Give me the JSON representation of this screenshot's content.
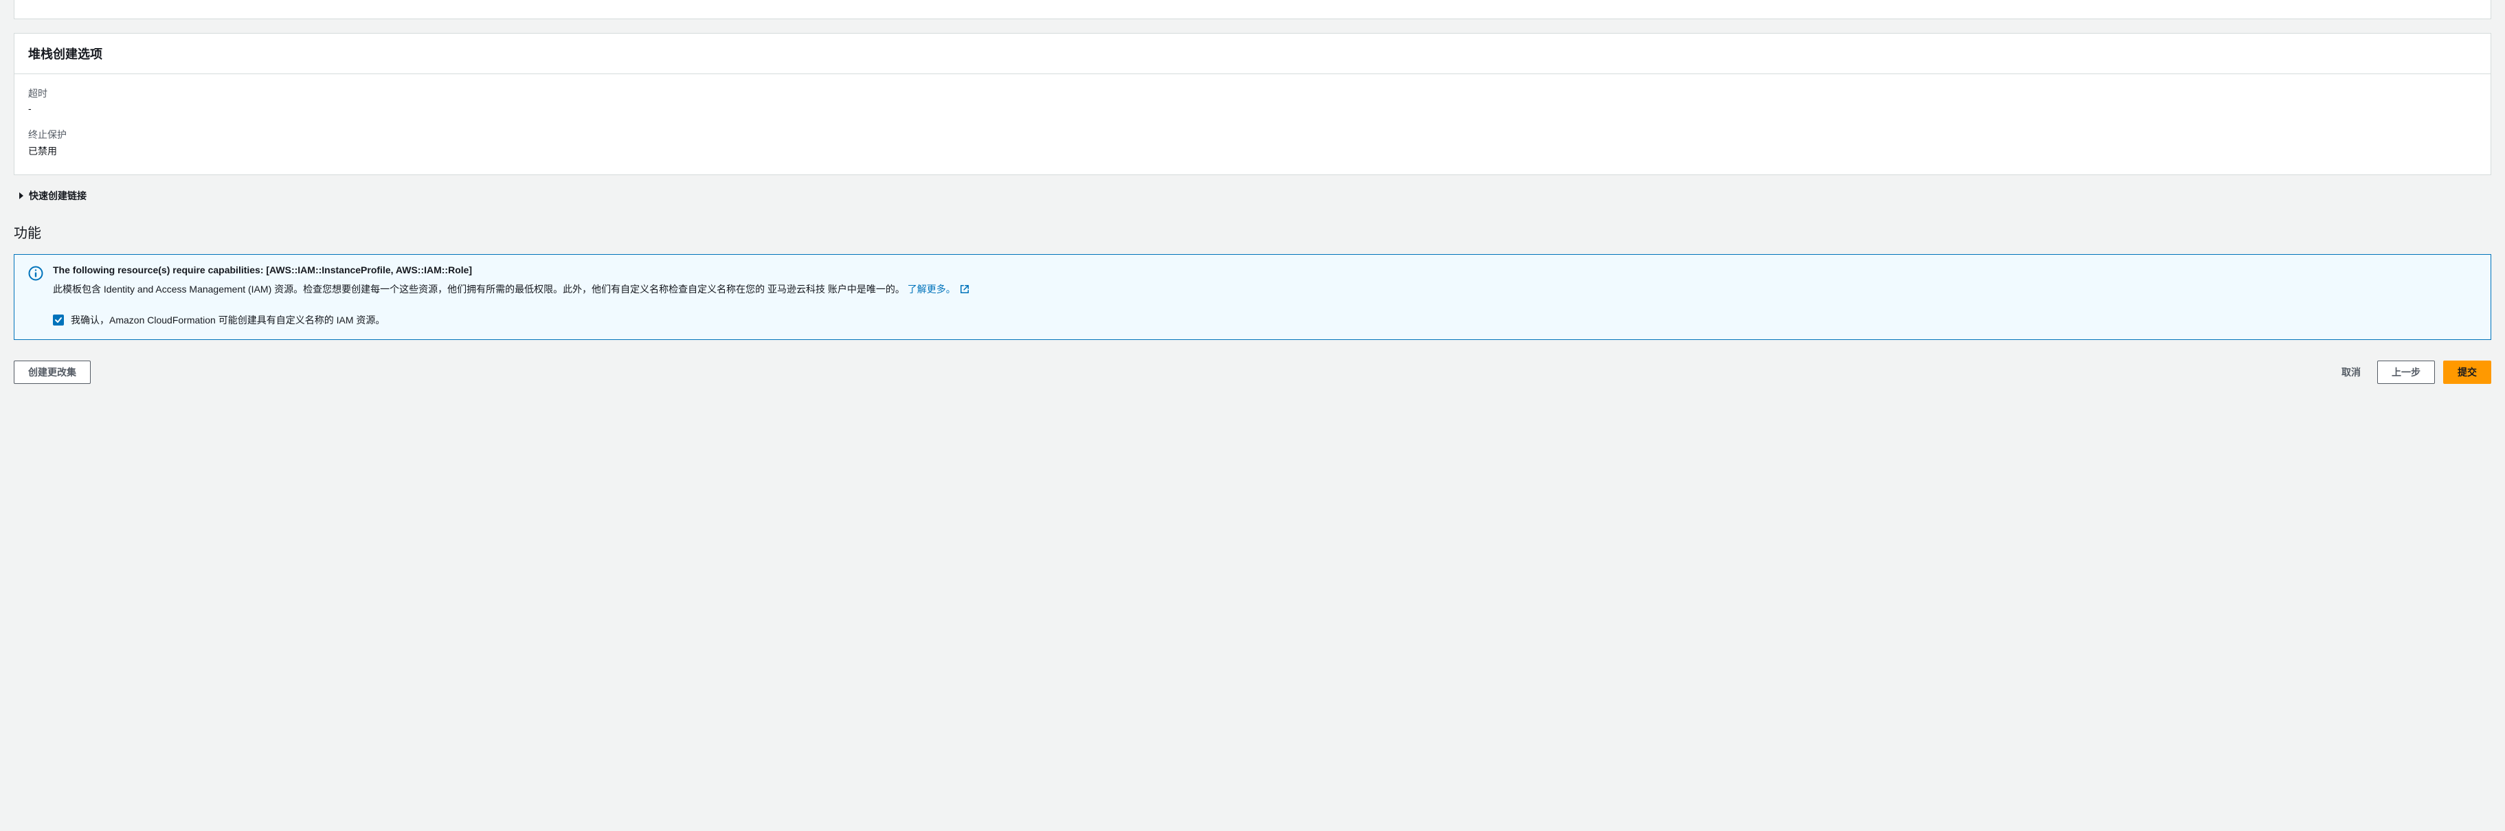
{
  "stackOptions": {
    "header": "堆栈创建选项",
    "timeout": {
      "label": "超时",
      "value": "-"
    },
    "terminationProtection": {
      "label": "终止保护",
      "value": "已禁用"
    }
  },
  "quickCreate": {
    "label": "快速创建链接"
  },
  "capabilities": {
    "heading": "功能",
    "alert": {
      "title": "The following resource(s) require capabilities: [AWS::IAM::InstanceProfile, AWS::IAM::Role]",
      "body": "此模板包含 Identity and Access Management (IAM) 资源。检查您想要创建每一个这些资源，他们拥有所需的最低权限。此外，他们有自定义名称检查自定义名称在您的 亚马逊云科技 账户中是唯一的。",
      "learnMore": "了解更多。",
      "checkboxLabel": "我确认，Amazon CloudFormation 可能创建具有自定义名称的 IAM 资源。"
    }
  },
  "footer": {
    "createChangeSet": "创建更改集",
    "cancel": "取消",
    "previous": "上一步",
    "submit": "提交"
  }
}
